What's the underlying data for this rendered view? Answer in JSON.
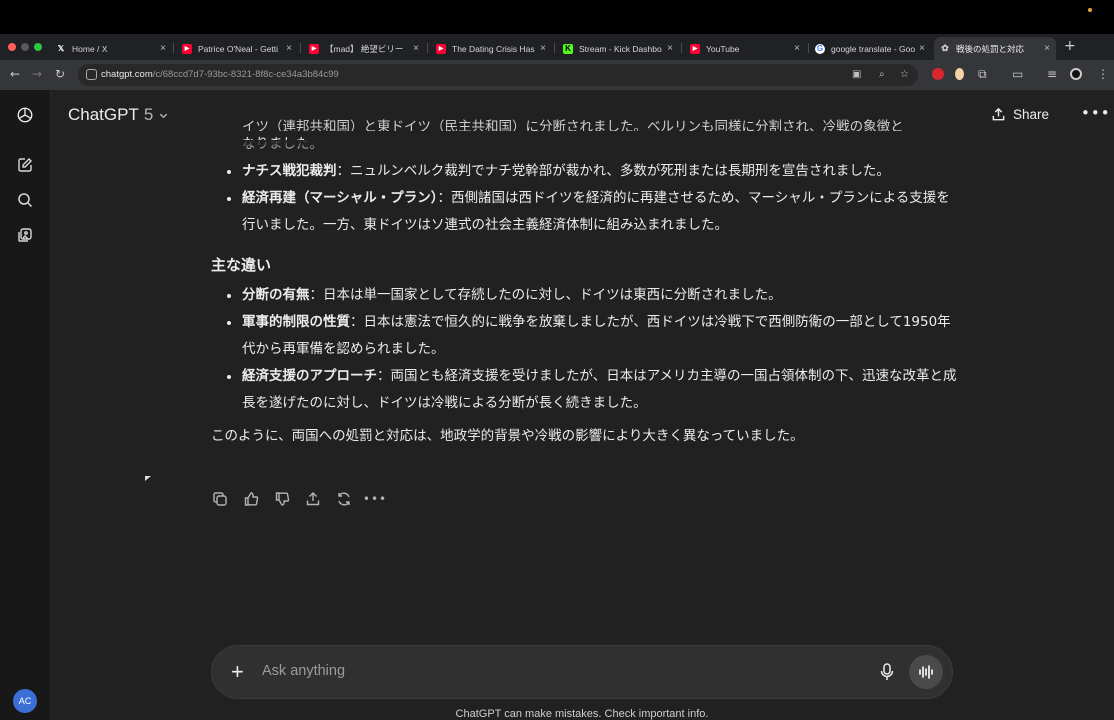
{
  "browser": {
    "tabs": [
      {
        "title": "Home / X",
        "icon": "x-logo-icon",
        "color": "#ffffff"
      },
      {
        "title": "Patrice O'Neal - Getti",
        "icon": "youtube-icon",
        "color": "#ff0033"
      },
      {
        "title": "【mad】 絶望ビリー",
        "icon": "youtube-icon",
        "color": "#ff0033"
      },
      {
        "title": "The Dating Crisis Has",
        "icon": "youtube-icon",
        "color": "#ff0033"
      },
      {
        "title": "Stream - Kick Dashbo",
        "icon": "kick-icon",
        "color": "#53fc18"
      },
      {
        "title": "YouTube",
        "icon": "youtube-icon",
        "color": "#ff0033"
      },
      {
        "title": "google translate - Goo",
        "icon": "google-icon",
        "color": "#4285f4"
      },
      {
        "title": "戦後の処罰と対応",
        "icon": "chatgpt-icon",
        "color": "#cccccc"
      }
    ],
    "url_host": "chatgpt.com",
    "url_path": "/c/68ccd7d7-93bc-8321-8f8c-ce34a3b84c99"
  },
  "app": {
    "model_name": "ChatGPT",
    "model_version": "5",
    "share_label": "Share",
    "avatar_initials": "AC"
  },
  "message": {
    "top_partial_1": "イツ（連邦共和国）と東ドイツ（民主共和国）に分断されました。ベルリンも同様に分割され、冷戦の象徴と",
    "top_partial_2": "なりました。",
    "bullets_a": [
      {
        "title": "ナチス戦犯裁判",
        "text": "：ニュルンベルク裁判でナチ党幹部が裁かれ、多数が死刑または長期刑を宣告されました。"
      },
      {
        "title": "経済再建（マーシャル・プラン）",
        "text": "：西側諸国は西ドイツを経済的に再建させるため、マーシャル・プランによる支援を行いました。一方、東ドイツはソ連式の社会主義経済体制に組み込まれました。"
      }
    ],
    "section_title": "主な違い",
    "bullets_b": [
      {
        "title": "分断の有無",
        "text": "：日本は単一国家として存続したのに対し、ドイツは東西に分断されました。"
      },
      {
        "title": "軍事的制限の性質",
        "text": "：日本は憲法で恒久的に戦争を放棄しましたが、西ドイツは冷戦下で西側防衛の一部として1950年代から再軍備を認められました。"
      },
      {
        "title": "経済支援のアプローチ",
        "text": "：両国とも経済支援を受けましたが、日本はアメリカ主導の一国占領体制の下、迅速な改革と成長を遂げたのに対し、ドイツは冷戦による分断が長く続きました。"
      }
    ],
    "conclusion": "このように、両国への処罰と対応は、地政学的背景や冷戦の影響により大きく異なっていました。"
  },
  "composer": {
    "placeholder": "Ask anything"
  },
  "disclaimer": "ChatGPT can make mistakes. Check important info."
}
